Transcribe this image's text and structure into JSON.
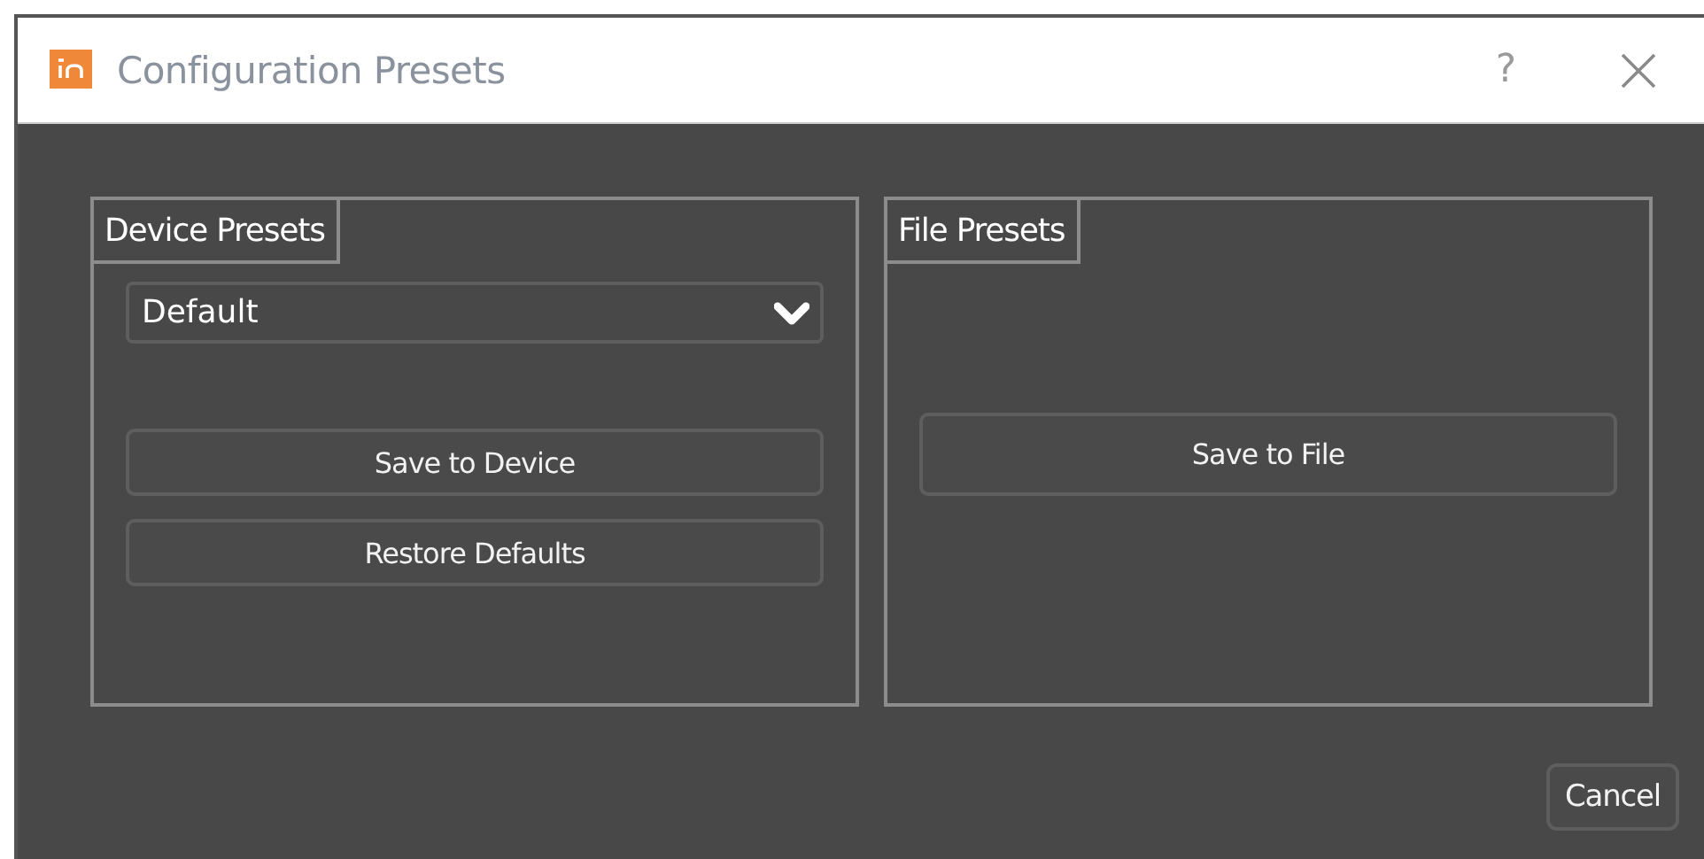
{
  "window": {
    "title": "Configuration Presets",
    "help": "?"
  },
  "groups": [
    {
      "title": "Device Presets",
      "dropdown": {
        "value": "Default"
      },
      "buttons": [
        "Save to Device",
        "Restore Defaults"
      ]
    },
    {
      "title": "File Presets",
      "buttons": [
        "Save to File"
      ]
    }
  ],
  "buttons": [
    "Cancel"
  ]
}
